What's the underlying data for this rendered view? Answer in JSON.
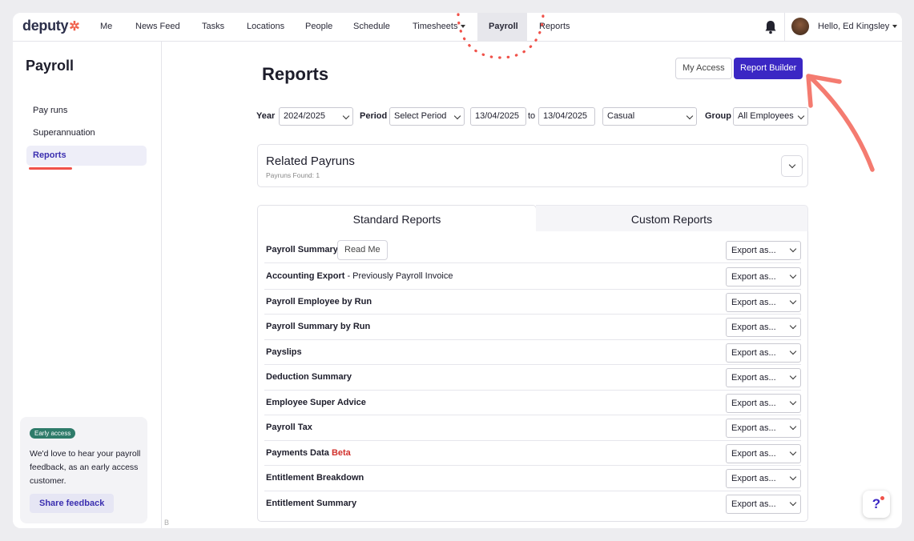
{
  "brand": {
    "name": "deputy",
    "star": "✲",
    "accent": "#3b27c4",
    "annotation_color": "#f0524a"
  },
  "nav": {
    "items": [
      {
        "label": "Me"
      },
      {
        "label": "News Feed"
      },
      {
        "label": "Tasks"
      },
      {
        "label": "Locations"
      },
      {
        "label": "People"
      },
      {
        "label": "Schedule"
      },
      {
        "label": "Timesheets"
      },
      {
        "label": "Payroll"
      },
      {
        "label": "Reports"
      }
    ],
    "active": "Payroll",
    "user_greeting": "Hello, Ed Kingsley"
  },
  "sidebar": {
    "title": "Payroll",
    "items": [
      {
        "label": "Pay runs"
      },
      {
        "label": "Superannuation"
      },
      {
        "label": "Reports"
      }
    ],
    "active": "Reports",
    "early_access": {
      "badge": "Early access",
      "text": "We'd love to hear your payroll feedback, as an early access customer.",
      "button": "Share feedback"
    },
    "footer_char": "B"
  },
  "main": {
    "title": "Reports",
    "my_access_label": "My Access",
    "report_builder_label": "Report Builder",
    "filters": {
      "year_label": "Year",
      "year_value": "2024/2025",
      "period_label": "Period",
      "period_value": "Select Period",
      "date_from": "13/04/2025",
      "to_label": "to",
      "date_to": "13/04/2025",
      "type_value": "Casual",
      "group_label": "Group",
      "group_value": "All Employees"
    },
    "related_payruns": {
      "title": "Related Payruns",
      "subtitle": "Payruns Found: 1"
    },
    "tabs": [
      {
        "label": "Standard Reports"
      },
      {
        "label": "Custom Reports"
      }
    ],
    "active_tab": "Standard Reports",
    "read_me_label": "Read Me",
    "export_label": "Export as...",
    "reports": [
      {
        "name": "Payroll Summary"
      },
      {
        "name": "Accounting Export",
        "suffix": " - Previously Payroll Invoice"
      },
      {
        "name": "Payroll Employee by Run"
      },
      {
        "name": "Payroll Summary by Run"
      },
      {
        "name": "Payslips"
      },
      {
        "name": "Deduction Summary"
      },
      {
        "name": "Employee Super Advice"
      },
      {
        "name": "Payroll Tax"
      },
      {
        "name": "Payments Data",
        "tag": "Beta"
      },
      {
        "name": "Entitlement Breakdown"
      },
      {
        "name": "Entitlement Summary"
      }
    ]
  },
  "help_label": "?"
}
